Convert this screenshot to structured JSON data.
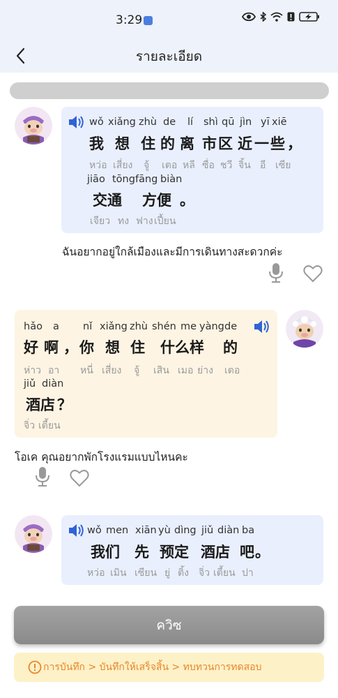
{
  "status_bar": {
    "time": "3:29",
    "icons": [
      "app-notification-icon",
      "eye-icon",
      "bluetooth-icon",
      "wifi-icon",
      "alert-icon",
      "battery-charging-icon"
    ]
  },
  "header": {
    "title": "รายละเอียด",
    "back_icon": "chevron-left-icon"
  },
  "progress": {
    "fraction": 1.0
  },
  "messages": [
    {
      "side": "left",
      "lines": [
        {
          "pinyin": [
            "wǒ",
            "xiǎng",
            "zhù",
            "de",
            "lí",
            "shì",
            "qū",
            "jìn",
            "yī",
            "xiē"
          ],
          "hanzi": [
            "我",
            "想",
            "住",
            "的",
            "离",
            "市",
            "区",
            "近",
            "一",
            "些",
            "，"
          ],
          "thai": [
            "หว่อ",
            "เสี่ยง",
            "จู้",
            "เตอ",
            "หลี",
            "ซื่อ",
            "ชวี",
            "จิ้น",
            "อี",
            "เซีย"
          ]
        },
        {
          "pinyin": [
            "jiāo",
            "tōng",
            "fāng",
            "biàn"
          ],
          "hanzi": [
            "交通",
            "方便",
            "。"
          ],
          "thai": [
            "เจียว",
            "ทง",
            "ฟาง",
            "เปี้ยน"
          ]
        }
      ],
      "translation": "ฉันอยากอยู่ใกล้เมืองและมีการเดินทางสะดวกค่ะ"
    },
    {
      "side": "right",
      "lines": [
        {
          "pinyin": [
            "hǎo",
            "a",
            "nǐ",
            "xiǎng",
            "zhù",
            "shén",
            "me",
            "yàng",
            "de"
          ],
          "hanzi": [
            "好",
            "啊",
            "，",
            "你",
            "想",
            "住",
            "什么样",
            "的"
          ],
          "thai": [
            "ห่าว",
            "อา",
            "หนี่",
            "เสี่ยง",
            "จู้",
            "เสิน",
            "เมอ",
            "ย่าง",
            "เตอ"
          ]
        },
        {
          "pinyin": [
            "jiǔ",
            "diàn"
          ],
          "hanzi": [
            "酒店",
            "？"
          ],
          "thai": [
            "จิ่ว",
            "เตี้ยน"
          ]
        }
      ],
      "translation": "โอเค คุณอยากพักโรงแรมแบบไหนคะ"
    },
    {
      "side": "left",
      "lines": [
        {
          "pinyin": [
            "wǒ",
            "men",
            "xiān",
            "yù",
            "dìng",
            "jiǔ",
            "diàn",
            "ba"
          ],
          "hanzi": [
            "我们",
            "先",
            "预定",
            "酒店",
            "吧",
            "。"
          ],
          "thai": [
            "หว่อ",
            "เมิน",
            "เซียน",
            "ยู่",
            "ติ้ง",
            "จิ่ว",
            "เตี้ยน",
            "ปา"
          ]
        }
      ]
    }
  ],
  "quiz_button": {
    "label": "ควิซ"
  },
  "hint": {
    "text": "การบันทึก > บันทึกให้เสร็จสิ้น > ทบทวนการทดสอบ",
    "icon": "alert-circle-icon"
  },
  "colors": {
    "header_bg": "#eef2fb",
    "bubble_blue": "#e9effd",
    "bubble_cream": "#fdf4e3",
    "speaker_blue": "#2f63d6",
    "quiz_button": "#969696",
    "hint_bg": "#fdf1c7",
    "hint_text": "#e8862b"
  }
}
